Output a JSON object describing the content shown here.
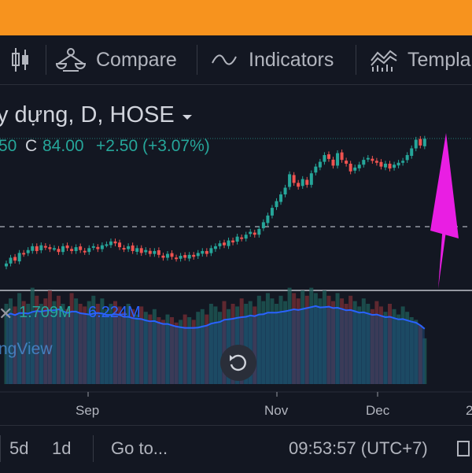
{
  "toolbar": {
    "compare_label": "Compare",
    "indicators_label": "Indicators",
    "templates_label": "Templa"
  },
  "legend": {
    "symbol": "y dựng, D, HOSE",
    "open_partial": "50",
    "close_key": "C",
    "close_value": "84.00",
    "change": "+2.50 (+3.07%)",
    "volume_value": "1.709M",
    "volume_ma": "6.224M",
    "watermark": "ngView"
  },
  "colors": {
    "up": "#26a69a",
    "down": "#ef5350",
    "arrow": "#e91ee3",
    "volume_ma_line": "#2962ff",
    "accent_bar": "#F7931E"
  },
  "chart_data": {
    "type": "candlestick",
    "x_ticks": [
      "Sep",
      "Nov",
      "Dec",
      "2"
    ],
    "close_last": 84.0,
    "closes": [
      71.0,
      71.6,
      71.3,
      72.1,
      72.0,
      72.4,
      72.8,
      72.3,
      72.9,
      72.7,
      72.5,
      72.6,
      72.2,
      72.8,
      72.6,
      72.3,
      72.7,
      72.4,
      72.2,
      72.6,
      72.8,
      72.5,
      72.9,
      73.0,
      73.3,
      73.1,
      72.7,
      72.5,
      72.8,
      72.3,
      72.6,
      72.1,
      72.4,
      72.0,
      72.3,
      71.9,
      71.6,
      72.0,
      71.7,
      71.5,
      71.8,
      71.6,
      71.9,
      71.7,
      72.1,
      72.3,
      72.0,
      72.6,
      72.8,
      73.1,
      72.9,
      73.4,
      73.2,
      73.8,
      73.6,
      74.0,
      74.3,
      74.0,
      74.6,
      75.3,
      76.0,
      76.8,
      77.5,
      78.2,
      78.9,
      80.3,
      79.4,
      79.0,
      79.8,
      79.2,
      80.4,
      81.1,
      81.6,
      82.3,
      81.9,
      81.2,
      82.5,
      81.8,
      81.4,
      80.6,
      81.0,
      81.3,
      81.8,
      82.0,
      81.7,
      81.5,
      81.1,
      81.4,
      80.9,
      81.3,
      81.5,
      81.7,
      82.3,
      83.0,
      83.9,
      83.3,
      84.0
    ],
    "volumes": [
      3.0,
      3.2,
      2.9,
      3.4,
      3.1,
      3.0,
      3.6,
      3.3,
      3.0,
      3.2,
      3.5,
      3.1,
      3.3,
      3.0,
      2.8,
      3.4,
      3.2,
      3.0,
      2.9,
      3.1,
      3.3,
      3.0,
      3.2,
      2.8,
      3.0,
      3.1,
      2.9,
      2.7,
      3.0,
      2.8,
      2.6,
      2.9,
      2.7,
      2.6,
      2.8,
      2.5,
      2.4,
      2.6,
      2.5,
      2.3,
      2.4,
      2.6,
      2.5,
      2.4,
      2.7,
      2.8,
      2.6,
      3.0,
      2.9,
      2.7,
      3.1,
      2.8,
      3.0,
      2.9,
      3.2,
      3.0,
      3.1,
      2.9,
      3.3,
      3.1,
      3.4,
      3.2,
      3.0,
      3.3,
      3.1,
      3.6,
      3.4,
      3.2,
      3.5,
      3.3,
      3.6,
      3.4,
      3.2,
      3.5,
      3.3,
      3.1,
      3.4,
      3.2,
      3.0,
      3.3,
      3.1,
      2.9,
      3.2,
      3.0,
      2.8,
      3.1,
      2.9,
      2.7,
      3.0,
      2.8,
      2.6,
      2.9,
      2.7,
      2.5,
      2.4,
      2.2,
      1.709
    ],
    "volume_ma": 6.224
  },
  "bottom": {
    "range_5d": "5d",
    "range_1d": "1d",
    "goto_label": "Go to...",
    "time_label": "09:53:57 (UTC+7)"
  }
}
